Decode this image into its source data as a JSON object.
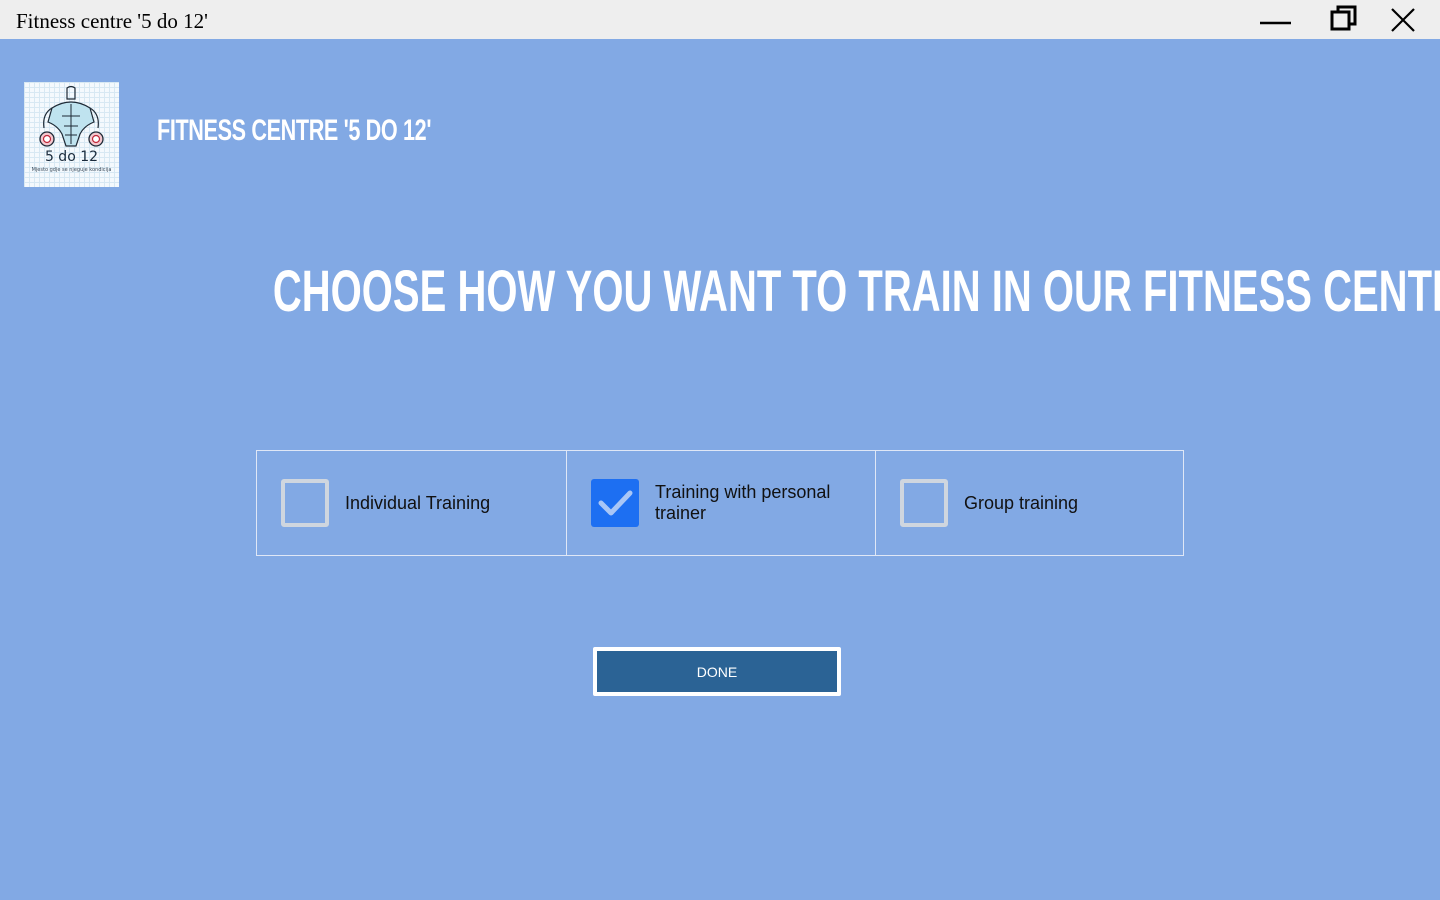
{
  "window": {
    "title": "Fitness centre '5 do 12'",
    "controls": [
      "minimize",
      "restore",
      "close"
    ]
  },
  "header": {
    "logo_text": "5 do 12",
    "logo_tagline": "Mjesto gdje se njeguje kondicija",
    "app_name": "FITNESS CENTRE '5 DO 12'"
  },
  "main": {
    "heading": "CHOOSE HOW YOU WANT TO TRAIN IN OUR FITNESS CENTRE",
    "options": [
      {
        "label": "Individual Training",
        "checked": false
      },
      {
        "label": "Training with personal trainer",
        "checked": true
      },
      {
        "label": "Group training",
        "checked": false
      }
    ],
    "done_label": "DONE"
  },
  "colors": {
    "background": "#82a9e4",
    "titlebar": "#eeeeee",
    "checkbox_checked": "#1d6ff2",
    "button": "#2b6395"
  }
}
